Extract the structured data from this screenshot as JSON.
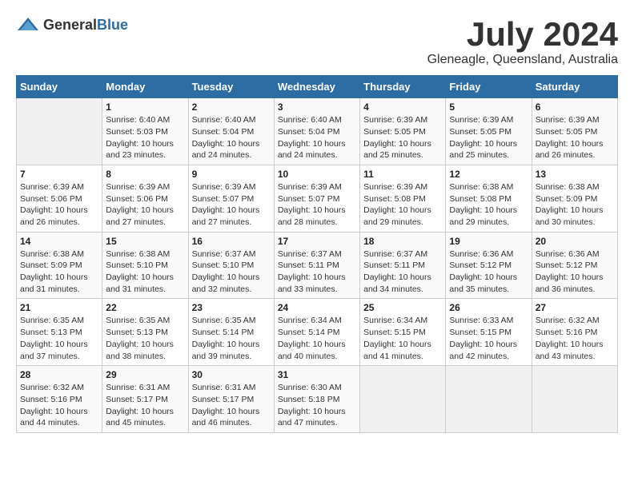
{
  "header": {
    "logo_general": "General",
    "logo_blue": "Blue",
    "month": "July 2024",
    "location": "Gleneagle, Queensland, Australia"
  },
  "weekdays": [
    "Sunday",
    "Monday",
    "Tuesday",
    "Wednesday",
    "Thursday",
    "Friday",
    "Saturday"
  ],
  "weeks": [
    [
      {
        "day": "",
        "sunrise": "",
        "sunset": "",
        "daylight": ""
      },
      {
        "day": "1",
        "sunrise": "Sunrise: 6:40 AM",
        "sunset": "Sunset: 5:03 PM",
        "daylight": "Daylight: 10 hours and 23 minutes."
      },
      {
        "day": "2",
        "sunrise": "Sunrise: 6:40 AM",
        "sunset": "Sunset: 5:04 PM",
        "daylight": "Daylight: 10 hours and 24 minutes."
      },
      {
        "day": "3",
        "sunrise": "Sunrise: 6:40 AM",
        "sunset": "Sunset: 5:04 PM",
        "daylight": "Daylight: 10 hours and 24 minutes."
      },
      {
        "day": "4",
        "sunrise": "Sunrise: 6:39 AM",
        "sunset": "Sunset: 5:05 PM",
        "daylight": "Daylight: 10 hours and 25 minutes."
      },
      {
        "day": "5",
        "sunrise": "Sunrise: 6:39 AM",
        "sunset": "Sunset: 5:05 PM",
        "daylight": "Daylight: 10 hours and 25 minutes."
      },
      {
        "day": "6",
        "sunrise": "Sunrise: 6:39 AM",
        "sunset": "Sunset: 5:05 PM",
        "daylight": "Daylight: 10 hours and 26 minutes."
      }
    ],
    [
      {
        "day": "7",
        "sunrise": "Sunrise: 6:39 AM",
        "sunset": "Sunset: 5:06 PM",
        "daylight": "Daylight: 10 hours and 26 minutes."
      },
      {
        "day": "8",
        "sunrise": "Sunrise: 6:39 AM",
        "sunset": "Sunset: 5:06 PM",
        "daylight": "Daylight: 10 hours and 27 minutes."
      },
      {
        "day": "9",
        "sunrise": "Sunrise: 6:39 AM",
        "sunset": "Sunset: 5:07 PM",
        "daylight": "Daylight: 10 hours and 27 minutes."
      },
      {
        "day": "10",
        "sunrise": "Sunrise: 6:39 AM",
        "sunset": "Sunset: 5:07 PM",
        "daylight": "Daylight: 10 hours and 28 minutes."
      },
      {
        "day": "11",
        "sunrise": "Sunrise: 6:39 AM",
        "sunset": "Sunset: 5:08 PM",
        "daylight": "Daylight: 10 hours and 29 minutes."
      },
      {
        "day": "12",
        "sunrise": "Sunrise: 6:38 AM",
        "sunset": "Sunset: 5:08 PM",
        "daylight": "Daylight: 10 hours and 29 minutes."
      },
      {
        "day": "13",
        "sunrise": "Sunrise: 6:38 AM",
        "sunset": "Sunset: 5:09 PM",
        "daylight": "Daylight: 10 hours and 30 minutes."
      }
    ],
    [
      {
        "day": "14",
        "sunrise": "Sunrise: 6:38 AM",
        "sunset": "Sunset: 5:09 PM",
        "daylight": "Daylight: 10 hours and 31 minutes."
      },
      {
        "day": "15",
        "sunrise": "Sunrise: 6:38 AM",
        "sunset": "Sunset: 5:10 PM",
        "daylight": "Daylight: 10 hours and 31 minutes."
      },
      {
        "day": "16",
        "sunrise": "Sunrise: 6:37 AM",
        "sunset": "Sunset: 5:10 PM",
        "daylight": "Daylight: 10 hours and 32 minutes."
      },
      {
        "day": "17",
        "sunrise": "Sunrise: 6:37 AM",
        "sunset": "Sunset: 5:11 PM",
        "daylight": "Daylight: 10 hours and 33 minutes."
      },
      {
        "day": "18",
        "sunrise": "Sunrise: 6:37 AM",
        "sunset": "Sunset: 5:11 PM",
        "daylight": "Daylight: 10 hours and 34 minutes."
      },
      {
        "day": "19",
        "sunrise": "Sunrise: 6:36 AM",
        "sunset": "Sunset: 5:12 PM",
        "daylight": "Daylight: 10 hours and 35 minutes."
      },
      {
        "day": "20",
        "sunrise": "Sunrise: 6:36 AM",
        "sunset": "Sunset: 5:12 PM",
        "daylight": "Daylight: 10 hours and 36 minutes."
      }
    ],
    [
      {
        "day": "21",
        "sunrise": "Sunrise: 6:35 AM",
        "sunset": "Sunset: 5:13 PM",
        "daylight": "Daylight: 10 hours and 37 minutes."
      },
      {
        "day": "22",
        "sunrise": "Sunrise: 6:35 AM",
        "sunset": "Sunset: 5:13 PM",
        "daylight": "Daylight: 10 hours and 38 minutes."
      },
      {
        "day": "23",
        "sunrise": "Sunrise: 6:35 AM",
        "sunset": "Sunset: 5:14 PM",
        "daylight": "Daylight: 10 hours and 39 minutes."
      },
      {
        "day": "24",
        "sunrise": "Sunrise: 6:34 AM",
        "sunset": "Sunset: 5:14 PM",
        "daylight": "Daylight: 10 hours and 40 minutes."
      },
      {
        "day": "25",
        "sunrise": "Sunrise: 6:34 AM",
        "sunset": "Sunset: 5:15 PM",
        "daylight": "Daylight: 10 hours and 41 minutes."
      },
      {
        "day": "26",
        "sunrise": "Sunrise: 6:33 AM",
        "sunset": "Sunset: 5:15 PM",
        "daylight": "Daylight: 10 hours and 42 minutes."
      },
      {
        "day": "27",
        "sunrise": "Sunrise: 6:32 AM",
        "sunset": "Sunset: 5:16 PM",
        "daylight": "Daylight: 10 hours and 43 minutes."
      }
    ],
    [
      {
        "day": "28",
        "sunrise": "Sunrise: 6:32 AM",
        "sunset": "Sunset: 5:16 PM",
        "daylight": "Daylight: 10 hours and 44 minutes."
      },
      {
        "day": "29",
        "sunrise": "Sunrise: 6:31 AM",
        "sunset": "Sunset: 5:17 PM",
        "daylight": "Daylight: 10 hours and 45 minutes."
      },
      {
        "day": "30",
        "sunrise": "Sunrise: 6:31 AM",
        "sunset": "Sunset: 5:17 PM",
        "daylight": "Daylight: 10 hours and 46 minutes."
      },
      {
        "day": "31",
        "sunrise": "Sunrise: 6:30 AM",
        "sunset": "Sunset: 5:18 PM",
        "daylight": "Daylight: 10 hours and 47 minutes."
      },
      {
        "day": "",
        "sunrise": "",
        "sunset": "",
        "daylight": ""
      },
      {
        "day": "",
        "sunrise": "",
        "sunset": "",
        "daylight": ""
      },
      {
        "day": "",
        "sunrise": "",
        "sunset": "",
        "daylight": ""
      }
    ]
  ]
}
